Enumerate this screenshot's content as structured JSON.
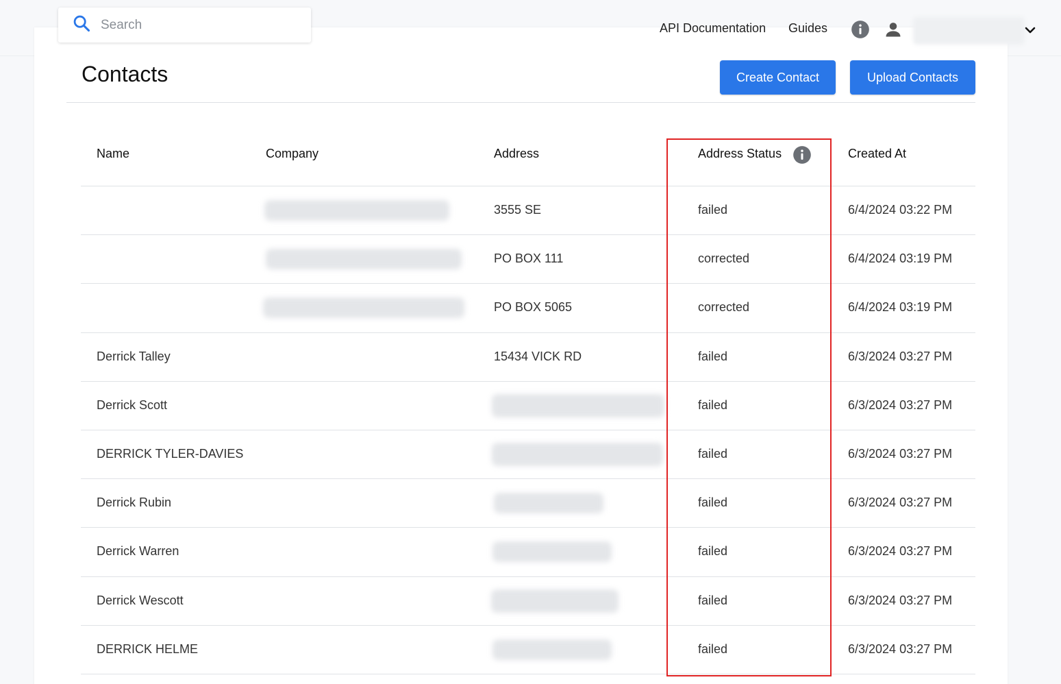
{
  "search": {
    "placeholder": "Search"
  },
  "nav": {
    "api_docs": "API Documentation",
    "guides": "Guides"
  },
  "page": {
    "title": "Contacts",
    "create_button": "Create Contact",
    "upload_button": "Upload Contacts"
  },
  "table": {
    "headers": [
      "Name",
      "Company",
      "Address",
      "Address Status",
      "Created At"
    ],
    "rows": [
      {
        "name": "",
        "company": "",
        "address": "3555 SE",
        "status": "failed",
        "created": "6/4/2024 03:22 PM"
      },
      {
        "name": "",
        "company": "",
        "address": "PO BOX 111",
        "status": "corrected",
        "created": "6/4/2024 03:19 PM"
      },
      {
        "name": "",
        "company": "",
        "address": "PO BOX 5065",
        "status": "corrected",
        "created": "6/4/2024 03:19 PM"
      },
      {
        "name": "Derrick Talley",
        "company": "",
        "address": "15434 VICK RD",
        "status": "failed",
        "created": "6/3/2024 03:27 PM"
      },
      {
        "name": "Derrick Scott",
        "company": "",
        "address": "",
        "status": "failed",
        "created": "6/3/2024 03:27 PM"
      },
      {
        "name": "DERRICK TYLER-DAVIES",
        "company": "",
        "address": "",
        "status": "failed",
        "created": "6/3/2024 03:27 PM"
      },
      {
        "name": "Derrick Rubin",
        "company": "",
        "address": "",
        "status": "failed",
        "created": "6/3/2024 03:27 PM"
      },
      {
        "name": "Derrick Warren",
        "company": "",
        "address": "",
        "status": "failed",
        "created": "6/3/2024 03:27 PM"
      },
      {
        "name": "Derrick Wescott",
        "company": "",
        "address": "",
        "status": "failed",
        "created": "6/3/2024 03:27 PM"
      },
      {
        "name": "DERRICK HELME",
        "company": "",
        "address": "",
        "status": "failed",
        "created": "6/3/2024 03:27 PM"
      }
    ]
  },
  "colors": {
    "primary": "#2a77e8",
    "highlight": "#e02424"
  },
  "icons": {
    "search": "search-icon",
    "info": "info-icon",
    "user": "user-icon",
    "chevron": "chevron-down-icon"
  }
}
